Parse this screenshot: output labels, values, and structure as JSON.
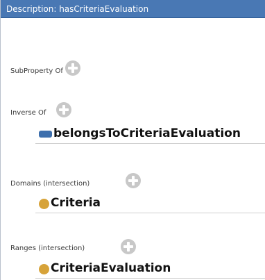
{
  "window": {
    "title": "Description: hasCriteriaEvaluation"
  },
  "sections": {
    "sub_property_of": {
      "label": "SubProperty Of"
    },
    "inverse_of": {
      "label": "Inverse Of",
      "item": "belongsToCriteriaEvaluation"
    },
    "domains": {
      "label": "Domains (intersection)",
      "item": "Criteria"
    },
    "ranges": {
      "label": "Ranges (intersection)",
      "item": "CriteriaEvaluation"
    }
  },
  "colors": {
    "titlebar": "#4978b4",
    "object_property_icon": "#3d6fad",
    "class_icon": "#d7a339",
    "add_button": "#c8c8c8"
  },
  "icons": {
    "add": "plus-circle-icon",
    "object_property": "object-property-icon",
    "class": "class-icon"
  }
}
